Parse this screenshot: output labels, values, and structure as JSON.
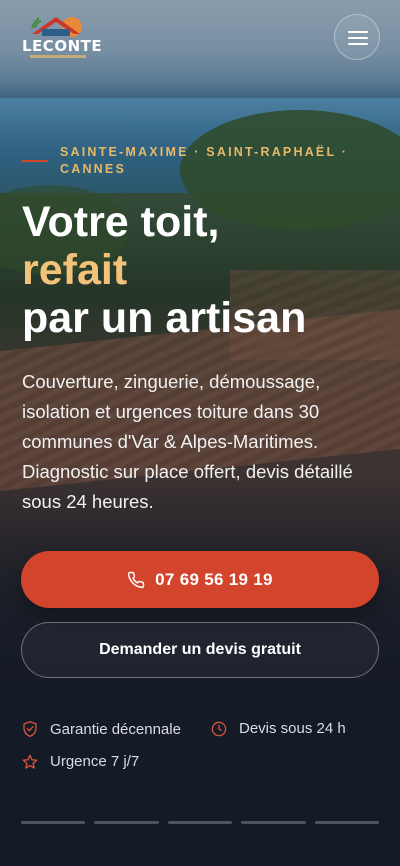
{
  "brand": {
    "name": "LECONTE"
  },
  "header": {
    "menu_label": "Menu"
  },
  "hero": {
    "eyebrow": "SAINTE-MAXIME · SAINT-RAPHAËL · CANNES",
    "headline_line1": "Votre toit,",
    "headline_accent": "refait",
    "headline_line3": "par un artisan",
    "lead": "Couverture, zinguerie, démoussage, isolation et urgences toiture dans 30 communes d'Var & Alpes-Maritimes. Diagnostic sur place offert, devis détaillé sous 24 heures."
  },
  "cta": {
    "call_label": "07 69 56 19 19",
    "quote_label": "Demander un devis gratuit"
  },
  "badges": [
    {
      "icon": "shield-check-icon",
      "label": "Garantie décennale"
    },
    {
      "icon": "clock-icon",
      "label": "Devis sous 24 h"
    },
    {
      "icon": "star-icon",
      "label": "Urgence 7 j/7"
    }
  ],
  "carousel": {
    "slides": 5
  },
  "colors": {
    "accent": "#d2442b",
    "highlight": "#f2c27a",
    "eyebrow": "#e7b86a",
    "background": "#141a26"
  }
}
